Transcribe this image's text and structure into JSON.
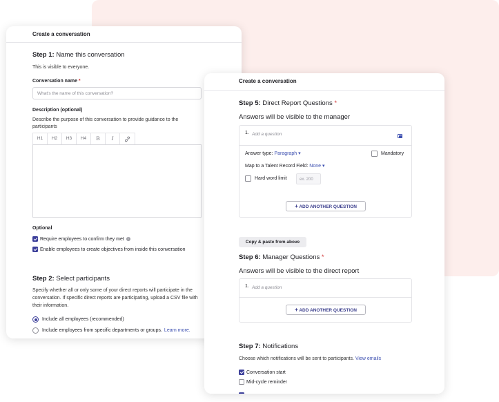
{
  "left_card": {
    "header": "Create a conversation",
    "step1": {
      "label": "Step 1:",
      "title": "Name this conversation",
      "subtitle": "This is visible to everyone."
    },
    "name_field": {
      "label": "Conversation name",
      "required": "*",
      "placeholder": "What's the name of this conversation?"
    },
    "description": {
      "label": "Description (optional)",
      "help": "Describe the purpose of this conversation to provide guidance to the participants",
      "toolbar": [
        "H1",
        "H2",
        "H3",
        "H4",
        "B",
        "I",
        "link-icon"
      ]
    },
    "optional": {
      "label": "Optional",
      "items": [
        {
          "text": "Require employees to confirm they met",
          "checked": true
        },
        {
          "text": "Enable employees to create objectives from inside this conversation",
          "checked": true
        }
      ]
    },
    "step2": {
      "label": "Step 2:",
      "title": "Select participants",
      "help": "Specify whether all or only some of your direct reports will participate in the conversation. If specific direct reports are participating, upload a CSV file with their information.",
      "options": [
        {
          "text": "Include all employees (recommended)",
          "selected": true
        },
        {
          "text": "Include employees from specific departments or groups.",
          "link": "Learn more.",
          "selected": false
        }
      ]
    }
  },
  "right_card": {
    "header": "Create a conversation",
    "step5": {
      "label": "Step 5:",
      "title": "Direct Report Questions",
      "required": "*",
      "subtitle": "Answers will be visible to the manager",
      "question": {
        "number": "1.",
        "placeholder": "Add a question",
        "answer_type_label": "Answer type:",
        "answer_type_value": "Paragraph",
        "mandatory_label": "Mandatory",
        "map_label": "Map to a Talent Record Field:",
        "map_value": "None",
        "hard_limit_label": "Hard word limit",
        "hard_limit_placeholder": "ex. 200"
      },
      "add_button": "ADD ANOTHER QUESTION"
    },
    "copy_button": "Copy & paste from above",
    "step6": {
      "label": "Step 6:",
      "title": "Manager Questions",
      "required": "*",
      "subtitle": "Answers will be visible to the direct report",
      "question": {
        "number": "1.",
        "placeholder": "Add a question"
      },
      "add_button": "ADD ANOTHER QUESTION"
    },
    "step7": {
      "label": "Step 7:",
      "title": "Notifications",
      "help": "Choose which notifications will be sent to participants.",
      "link": "View emails",
      "items": [
        {
          "text": "Conversation start",
          "checked": true
        },
        {
          "text": "Mid-cycle reminder",
          "checked": false
        }
      ]
    }
  },
  "colors": {
    "accent": "#3c3f9a",
    "link": "#3c4fb0",
    "required": "#d23b3b",
    "background_pink": "#fdeeec"
  }
}
